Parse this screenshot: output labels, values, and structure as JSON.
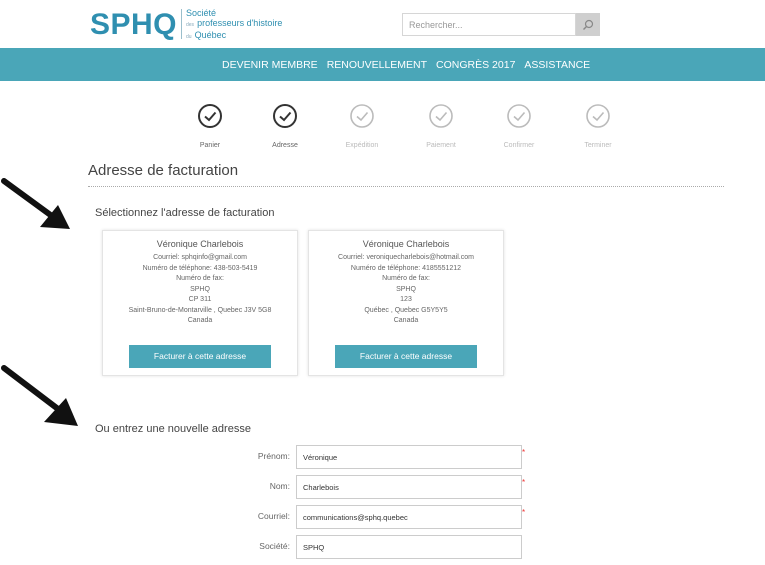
{
  "header": {
    "logo": "SPHQ",
    "org_line1": "Société",
    "org_line2": "professeurs d'histoire",
    "org_line3": "Québec",
    "org_prefix2": "des",
    "org_prefix3": "du"
  },
  "search": {
    "placeholder": "Rechercher..."
  },
  "nav": {
    "items": [
      "DEVENIR MEMBRE",
      "RENOUVELLEMENT",
      "CONGRÈS 2017",
      "ASSISTANCE"
    ]
  },
  "steps": [
    {
      "label": "Panier",
      "state": "done"
    },
    {
      "label": "Adresse",
      "state": "done"
    },
    {
      "label": "Expédition",
      "state": "todo"
    },
    {
      "label": "Paiement",
      "state": "todo"
    },
    {
      "label": "Confirmer",
      "state": "todo"
    },
    {
      "label": "Terminer",
      "state": "todo"
    }
  ],
  "page_title": "Adresse de facturation",
  "select_heading": "Sélectionnez l'adresse de facturation",
  "addresses": [
    {
      "name": "Véronique Charlebois",
      "lines": [
        "Courriel: sphqinfo@gmail.com",
        "Numéro de téléphone: 438-503-5419",
        "Numéro de fax:",
        "SPHQ",
        "CP 311",
        "Saint-Bruno-de-Montarville , Quebec J3V 5G8",
        "Canada"
      ],
      "button": "Facturer à cette adresse"
    },
    {
      "name": "Véronique Charlebois",
      "lines": [
        "Courriel: veroniquecharlebois@hotmail.com",
        "Numéro de téléphone: 4185551212",
        "Numéro de fax:",
        "SPHQ",
        "123",
        "Québec , Quebec G5Y5Y5",
        "Canada"
      ],
      "button": "Facturer à cette adresse"
    }
  ],
  "new_address_heading": "Ou entrez une nouvelle adresse",
  "form": {
    "prenom": {
      "label": "Prénom:",
      "value": "Véronique",
      "required": "*"
    },
    "nom": {
      "label": "Nom:",
      "value": "Charlebois",
      "required": "*"
    },
    "courriel": {
      "label": "Courriel:",
      "value": "communications@sphq.quebec",
      "required": "*"
    },
    "societe": {
      "label": "Société:",
      "value": "SPHQ"
    }
  },
  "colors": {
    "brand": "#2f8fb0",
    "nav_bg": "#4aa6b8",
    "button_bg": "#4aa6b8",
    "required": "#e33333"
  },
  "icons": {
    "search": "magnifier-icon",
    "step_done": "check-circle-icon",
    "annotation": "arrow-icon"
  }
}
